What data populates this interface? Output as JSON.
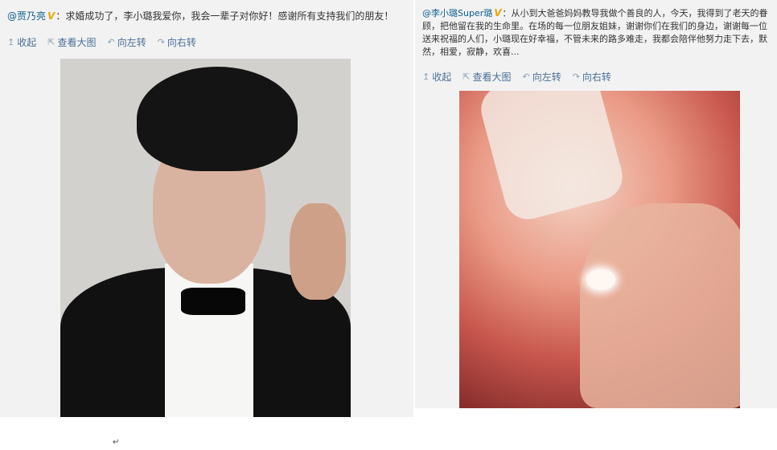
{
  "left_post": {
    "author": "@贾乃亮",
    "badge": "V",
    "text": "：求婚成功了，李小璐我爱你，我会一辈子对你好！感谢所有支持我们的朋友！",
    "actions": {
      "collapse": "收起",
      "view_large": "查看大图",
      "rotate_left": "向左转",
      "rotate_right": "向右转"
    }
  },
  "right_post": {
    "author": "@李小璐Super璐",
    "badge": "V",
    "text": "：从小到大爸爸妈妈教导我做个善良的人，今天，我得到了老天的眷顾，把他留在我的生命里。在场的每一位朋友姐妹，谢谢你们在我们的身边，谢谢每一位送来祝福的人们，小璐现在好幸福，不管未来的路多难走，我都会陪伴他努力走下去，默然，相爱，寂静，欢喜...",
    "actions": {
      "collapse": "收起",
      "view_large": "查看大图",
      "rotate_left": "向左转",
      "rotate_right": "向右转"
    }
  },
  "return_mark": "↵",
  "icons": {
    "collapse": "collapse-arrow-icon",
    "view_large": "external-view-icon",
    "rotate_left": "rotate-left-icon",
    "rotate_right": "rotate-right-icon"
  },
  "colors": {
    "link": "#4a6f96",
    "author": "#0b5f8f",
    "badge": "#f0a300",
    "card_bg": "#f2f2f2"
  }
}
